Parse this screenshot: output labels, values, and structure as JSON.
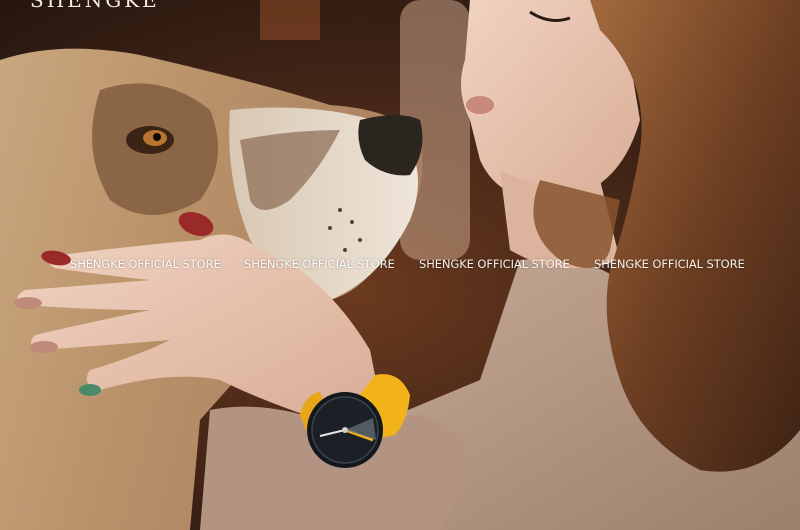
{
  "brand": {
    "logo_text": "SHENGKE"
  },
  "watermarks": [
    "SHENGKE OFFICIAL STORE",
    "SHENGKE OFFICIAL STORE",
    "SHENGKE OFFICIAL STORE",
    "SHENGKE OFFICIAL STORE"
  ],
  "colors": {
    "watch_strap": "#f2b21a",
    "watch_dial": "#1b2026",
    "nail_polish": "#9a2a2a",
    "sweater": "#b89a88",
    "hair": "#7a4a2a"
  }
}
